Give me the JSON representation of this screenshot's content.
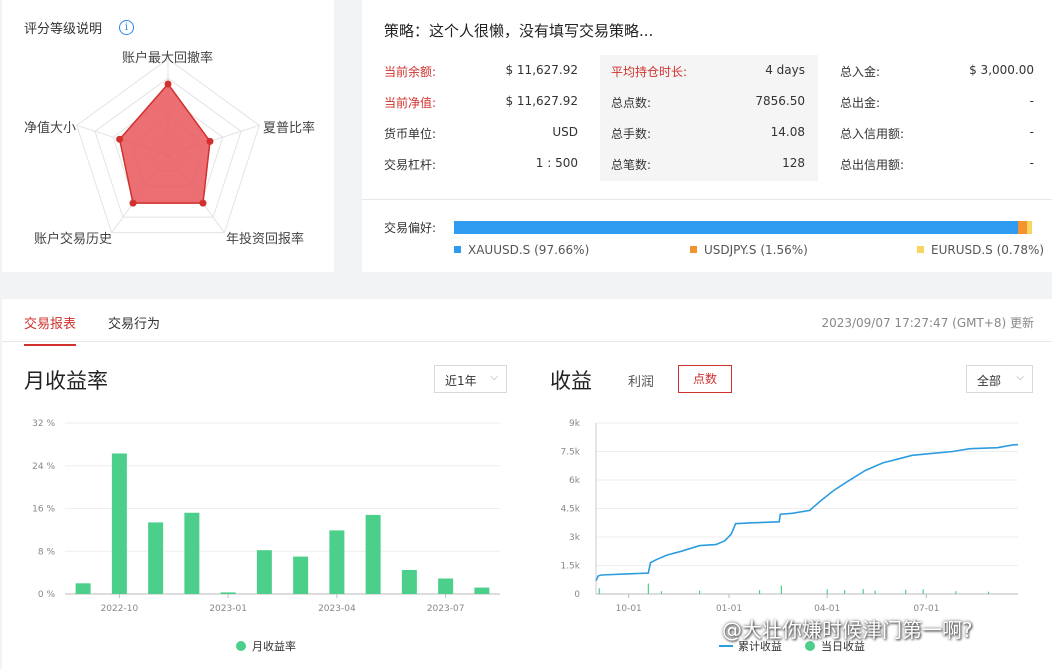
{
  "radar": {
    "title": "评分等级说明",
    "info_icon": "info-icon",
    "labels": [
      "账户最大回撤率",
      "夏普比率",
      "年投资回报率",
      "账户交易历史",
      "净值大小"
    ],
    "scores": [
      0.74,
      0.46,
      0.62,
      0.62,
      0.53
    ],
    "fill_color": "#e8565b",
    "stroke_color": "#d0312d"
  },
  "strategy": {
    "title": "策略：这个人很懒，没有填写交易策略...",
    "col1": [
      {
        "label": "当前余额:",
        "value": "$ 11,627.92",
        "highlight": true
      },
      {
        "label": "当前净值:",
        "value": "$ 11,627.92",
        "highlight": true
      },
      {
        "label": "货币单位:",
        "value": "USD",
        "highlight": false
      },
      {
        "label": "交易杠杆:",
        "value": "1 : 500",
        "highlight": false
      }
    ],
    "col2": [
      {
        "label": "平均持仓时长:",
        "value": "4 days",
        "highlight": true
      },
      {
        "label": "总点数:",
        "value": "7856.50",
        "highlight": false
      },
      {
        "label": "总手数:",
        "value": "14.08",
        "highlight": false
      },
      {
        "label": "总笔数:",
        "value": "128",
        "highlight": false
      }
    ],
    "col3": [
      {
        "label": "总入金:",
        "value": "$ 3,000.00"
      },
      {
        "label": "总出金:",
        "value": "-"
      },
      {
        "label": "总入信用额:",
        "value": "-"
      },
      {
        "label": "总出信用额:",
        "value": "-"
      }
    ],
    "preference": {
      "label": "交易偏好:",
      "items": [
        {
          "name": "XAUUSD.S",
          "pct_text": "(97.66%)",
          "pct": 97.66,
          "color": "#2f9bf0"
        },
        {
          "name": "USDJPY.S",
          "pct_text": "(1.56%)",
          "pct": 1.56,
          "color": "#f3922e"
        },
        {
          "name": "EURUSD.S",
          "pct_text": "(0.78%)",
          "pct": 0.78,
          "color": "#f7d560"
        }
      ]
    }
  },
  "report": {
    "tabs": [
      "交易报表",
      "交易行为"
    ],
    "active_tab": 0,
    "updated": "2023/09/07 17:27:47 (GMT+8) 更新"
  },
  "monthly": {
    "title": "月收益率",
    "range": "近1年",
    "legend": "月收益率"
  },
  "earnings": {
    "title": "收益",
    "tab_profit": "利润",
    "tab_points": "点数",
    "range": "全部",
    "legend_cum": "累计收益",
    "legend_daily": "当日收益"
  },
  "watermark": "@大壮你嫌时候津门第一啊?",
  "chart_data": [
    {
      "type": "bar",
      "title": "月收益率",
      "ytick_labels": [
        "0 %",
        "8 %",
        "16 %",
        "24 %",
        "32 %"
      ],
      "ylim": [
        0,
        32
      ],
      "xtick_labels": [
        "2022-10",
        "2023-01",
        "2023-04",
        "2023-07"
      ],
      "xtick_index": [
        1,
        4,
        7,
        10
      ],
      "series": [
        {
          "name": "月收益率",
          "color": "#4ccf8a",
          "values": [
            2.0,
            26.3,
            13.4,
            15.2,
            0.3,
            8.2,
            7.0,
            11.9,
            14.8,
            4.5,
            2.9,
            1.2
          ]
        }
      ]
    },
    {
      "type": "line",
      "title": "收益",
      "ytick_labels": [
        "0",
        "1.5k",
        "3k",
        "4.5k",
        "6k",
        "7.5k",
        "9k"
      ],
      "ylim": [
        0,
        9000
      ],
      "xtick_labels": [
        "10-01",
        "01-01",
        "04-01",
        "07-01"
      ],
      "xtick_days": [
        30,
        122,
        212,
        303
      ],
      "x_range_days": [
        0,
        387
      ],
      "series": [
        {
          "name": "累计收益",
          "color": "#2d9de0",
          "points": [
            [
              0,
              700
            ],
            [
              2,
              950
            ],
            [
              5,
              1000
            ],
            [
              25,
              1050
            ],
            [
              48,
              1100
            ],
            [
              50,
              1650
            ],
            [
              55,
              1800
            ],
            [
              65,
              2050
            ],
            [
              78,
              2250
            ],
            [
              95,
              2550
            ],
            [
              110,
              2600
            ],
            [
              118,
              2800
            ],
            [
              124,
              3150
            ],
            [
              128,
              3700
            ],
            [
              143,
              3750
            ],
            [
              168,
              3800
            ],
            [
              169,
              4200
            ],
            [
              180,
              4250
            ],
            [
              196,
              4400
            ],
            [
              206,
              4900
            ],
            [
              218,
              5450
            ],
            [
              230,
              5900
            ],
            [
              247,
              6500
            ],
            [
              263,
              6900
            ],
            [
              280,
              7150
            ],
            [
              290,
              7300
            ],
            [
              308,
              7400
            ],
            [
              327,
              7500
            ],
            [
              343,
              7650
            ],
            [
              368,
              7700
            ],
            [
              383,
              7850
            ],
            [
              387,
              7856.5
            ]
          ]
        },
        {
          "name": "当日收益",
          "color": "#4ccf8a",
          "type": "bar",
          "points": [
            [
              3,
              300
            ],
            [
              48,
              550
            ],
            [
              60,
              150
            ],
            [
              95,
              180
            ],
            [
              150,
              200
            ],
            [
              170,
              450
            ],
            [
              212,
              250
            ],
            [
              228,
              200
            ],
            [
              245,
              260
            ],
            [
              256,
              180
            ],
            [
              284,
              220
            ],
            [
              300,
              250
            ],
            [
              330,
              150
            ],
            [
              360,
              120
            ]
          ]
        }
      ]
    }
  ]
}
